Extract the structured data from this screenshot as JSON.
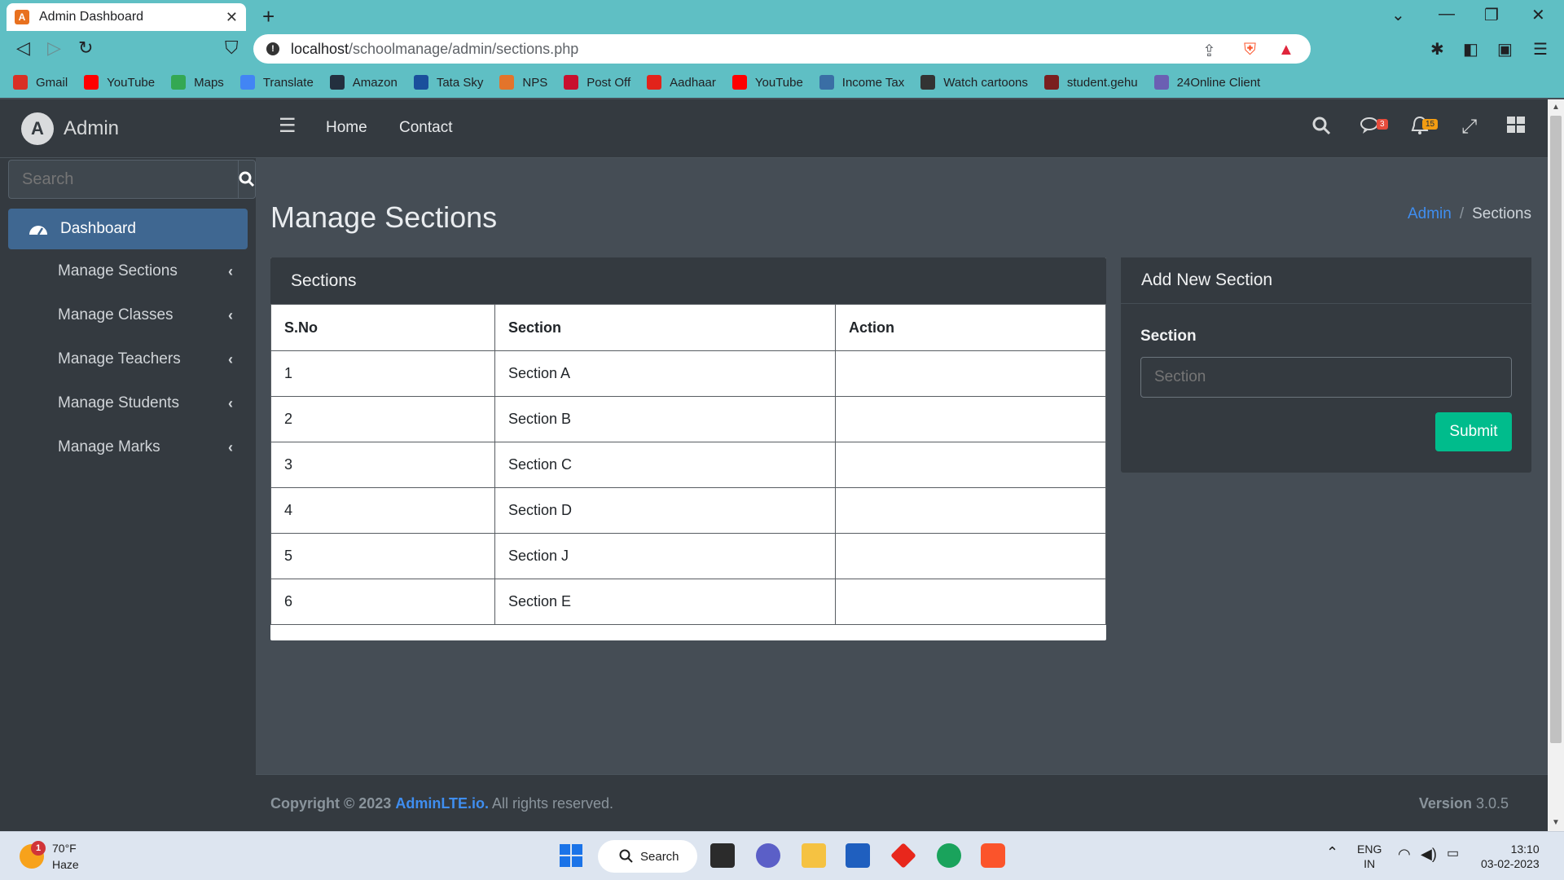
{
  "browser": {
    "tab_title": "Admin Dashboard",
    "url_host": "localhost",
    "url_path": "/schoolmanage/admin/sections.php",
    "bookmarks": [
      {
        "label": "Gmail",
        "icon": "gmail-icon",
        "color": "#d93025"
      },
      {
        "label": "YouTube",
        "icon": "youtube-icon",
        "color": "#ff0000"
      },
      {
        "label": "Maps",
        "icon": "maps-icon",
        "color": "#34a853"
      },
      {
        "label": "Translate",
        "icon": "translate-icon",
        "color": "#4285f4"
      },
      {
        "label": "Amazon",
        "icon": "amazon-icon",
        "color": "#232f3e"
      },
      {
        "label": "Tata Sky",
        "icon": "tatasky-icon",
        "color": "#1a4f9c"
      },
      {
        "label": "NPS",
        "icon": "nps-icon",
        "color": "#e3742b"
      },
      {
        "label": "Post Off",
        "icon": "postoffice-icon",
        "color": "#c8102e"
      },
      {
        "label": "Aadhaar",
        "icon": "aadhaar-icon",
        "color": "#e2231a"
      },
      {
        "label": "YouTube",
        "icon": "youtube-icon",
        "color": "#ff0000"
      },
      {
        "label": "Income Tax",
        "icon": "incometax-icon",
        "color": "#3a6ea5"
      },
      {
        "label": "Watch cartoons",
        "icon": "globe-icon",
        "color": "#333333"
      },
      {
        "label": "student.gehu",
        "icon": "gehu-icon",
        "color": "#7a1f1f"
      },
      {
        "label": "24Online Client",
        "icon": "24online-icon",
        "color": "#6b5fb3"
      }
    ]
  },
  "sidebar": {
    "brand": "Admin",
    "search_placeholder": "Search",
    "items": [
      {
        "label": "Dashboard",
        "active": true
      },
      {
        "label": "Manage Sections"
      },
      {
        "label": "Manage Classes"
      },
      {
        "label": "Manage Teachers"
      },
      {
        "label": "Manage Students"
      },
      {
        "label": "Manage Marks"
      }
    ]
  },
  "topnav": {
    "links": [
      "Home",
      "Contact"
    ],
    "messages_count": "3",
    "notifications_count": "15"
  },
  "page": {
    "title": "Manage Sections",
    "breadcrumb": {
      "parent": "Admin",
      "current": "Sections"
    }
  },
  "sections_card": {
    "title": "Sections",
    "columns": [
      "S.No",
      "Section",
      "Action"
    ],
    "rows": [
      [
        "1",
        "Section A",
        ""
      ],
      [
        "2",
        "Section B",
        ""
      ],
      [
        "3",
        "Section C",
        ""
      ],
      [
        "4",
        "Section D",
        ""
      ],
      [
        "5",
        "Section J",
        ""
      ],
      [
        "6",
        "Section E",
        ""
      ]
    ]
  },
  "add_card": {
    "title": "Add New Section",
    "field_label": "Section",
    "field_placeholder": "Section",
    "submit_label": "Submit"
  },
  "footer": {
    "copyright_prefix": "Copyright © 2023",
    "brand_link": "AdminLTE.io.",
    "rights": "All rights reserved.",
    "version_label": "Version",
    "version_value": "3.0.5"
  },
  "taskbar": {
    "temperature": "70°F",
    "condition": "Haze",
    "weather_badge": "1",
    "search_label": "Search",
    "lang_top": "ENG",
    "lang_bottom": "IN",
    "time": "13:10",
    "date": "03-02-2023"
  },
  "colors": {
    "accent": "#3f8ef0",
    "submit": "#00bc8c",
    "sidebar_active": "#3f6791",
    "msg_badge": "#e74c3c",
    "notif_badge": "#f39c12"
  }
}
